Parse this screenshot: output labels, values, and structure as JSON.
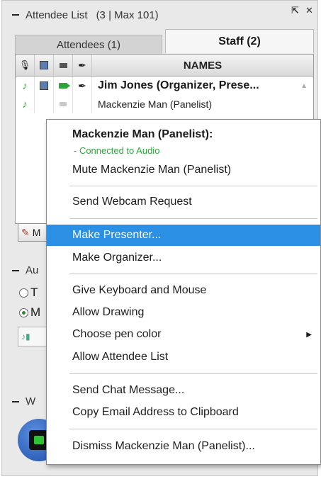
{
  "panel": {
    "title": "Attendee List",
    "count": "(3 | Max 101)",
    "popout_icon": "popout-icon",
    "close_icon": "close-icon"
  },
  "tabs": [
    {
      "label": "Attendees (1)",
      "active": false
    },
    {
      "label": "Staff (2)",
      "active": true
    }
  ],
  "list": {
    "column_icons": [
      "mic-icon",
      "screen-icon",
      "webcam-icon",
      "pen-icon"
    ],
    "names_header": "NAMES",
    "rows": [
      {
        "name": "Jim Jones (Organizer, Prese...",
        "audio": true,
        "screen": true,
        "webcam": true,
        "drawing": true
      },
      {
        "name": "Mackenzie Man (Panelist)",
        "audio": true,
        "screen": false,
        "webcam": false,
        "drawing": false
      }
    ]
  },
  "background": {
    "button_partial": "M",
    "audio_section_partial": "Au",
    "radio_1_partial": "T",
    "radio_2_partial": "M",
    "webcam_section_partial": "W"
  },
  "context_menu": {
    "title": "Mackenzie Man (Panelist):",
    "subtitle": "- Connected to Audio",
    "groups": [
      [
        "Mute Mackenzie Man (Panelist)"
      ],
      [
        "Send Webcam Request"
      ],
      [
        "Make Presenter...",
        "Make Organizer..."
      ],
      [
        "Give Keyboard and Mouse",
        "Allow Drawing",
        "Choose pen color",
        "Allow Attendee List"
      ],
      [
        "Send Chat Message...",
        "Copy Email Address to Clipboard"
      ],
      [
        "Dismiss Mackenzie Man (Panelist)..."
      ]
    ],
    "highlighted_item": "Make Presenter...",
    "submenu_item": "Choose pen color",
    "highlight_color": "#2b8fe4",
    "audio_status_color": "#2ea33b"
  }
}
